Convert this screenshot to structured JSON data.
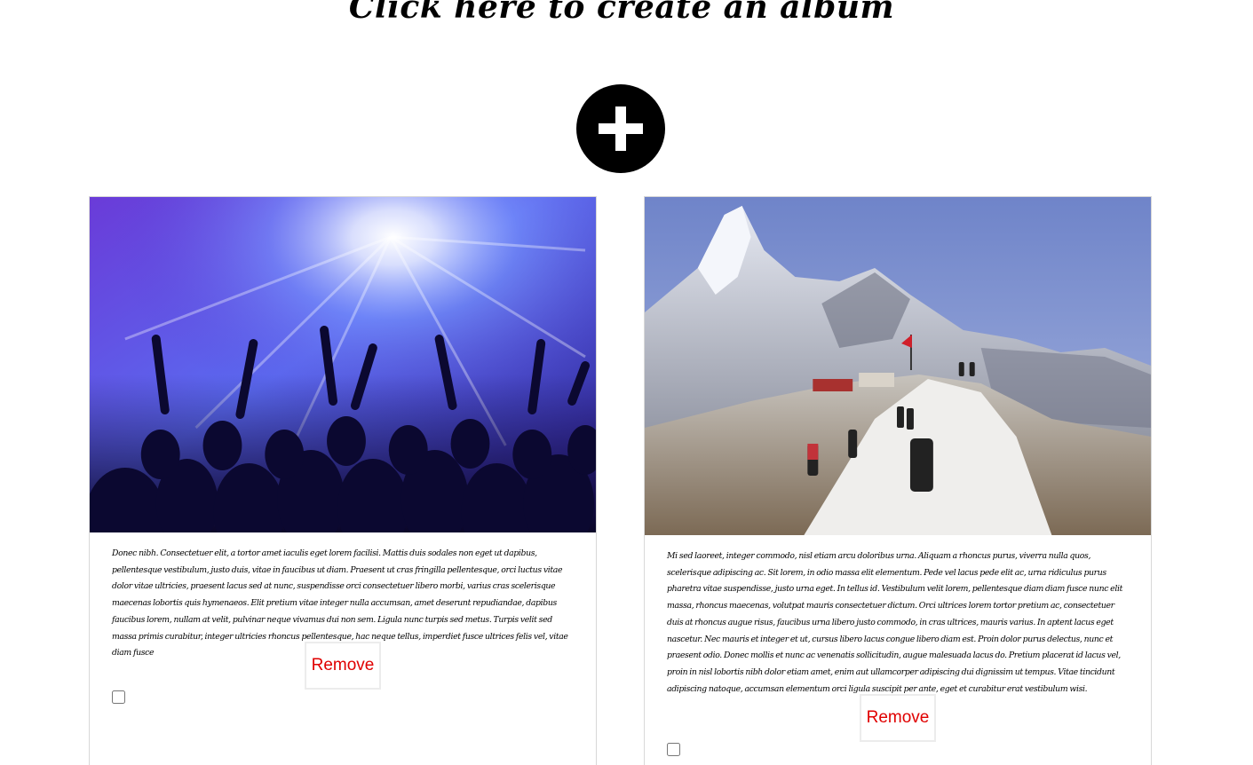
{
  "header": {
    "title": "Click here to create an album"
  },
  "add_album": {
    "icon": "plus-icon",
    "background_color": "#000000",
    "icon_color": "#ffffff"
  },
  "albums": [
    {
      "image_description_icon": "concert-crowd-image",
      "text": "Donec nibh. Consectetuer elit, a tortor amet iaculis eget lorem facilisi. Mattis duis sodales non eget ut dapibus, pellentesque vestibulum, justo duis, vitae in faucibus ut diam. Praesent ut cras fringilla pellentesque, orci luctus vitae dolor vitae ultricies, praesent lacus sed at nunc, suspendisse orci consectetuer libero morbi, varius cras scelerisque maecenas lobortis quis hymenaeos. Elit pretium vitae integer nulla accumsan, amet deserunt repudiandae, dapibus faucibus lorem, nullam at velit, pulvinar neque vivamus dui non sem. Ligula nunc turpis sed metus. Turpis velit sed massa primis curabitur, integer ultricies rhoncus pellentesque, hac neque tellus, imperdiet fusce ultrices felis vel, vitae diam fusce",
      "remove_label": "Remove",
      "selected": false
    },
    {
      "image_description_icon": "mountain-trek-image",
      "text": "Mi sed laoreet, integer commodo, nisl etiam arcu doloribus urna. Aliquam a rhoncus purus, viverra nulla quos, scelerisque adipiscing ac. Sit lorem, in odio massa elit elementum. Pede vel lacus pede elit ac, urna ridiculus purus pharetra vitae suspendisse, justo urna eget. In tellus id. Vestibulum velit lorem, pellentesque diam diam fusce nunc elit massa, rhoncus maecenas, volutpat mauris consectetuer dictum. Orci ultrices lorem tortor pretium ac, consectetuer duis at rhoncus augue risus, faucibus urna libero justo commodo, in cras ultrices, mauris varius. In aptent lacus eget nascetur. Nec mauris et integer et ut, cursus libero lacus congue libero diam est. Proin dolor purus delectus, nunc et praesent odio. Donec mollis et nunc ac venenatis sollicitudin, augue malesuada lacus do. Pretium placerat id lacus vel, proin in nisl lobortis nibh dolor etiam amet, enim aut ullamcorper adipiscing dui dignissim ut tempus. Vitae tincidunt adipiscing natoque, accumsan elementum orci ligula suscipit per ante, eget et curabitur erat vestibulum wisi.",
      "remove_label": "Remove",
      "selected": false
    }
  ],
  "colors": {
    "remove_text": "#e00000",
    "card_border": "#d8d8d8",
    "page_background": "#ffffff"
  }
}
